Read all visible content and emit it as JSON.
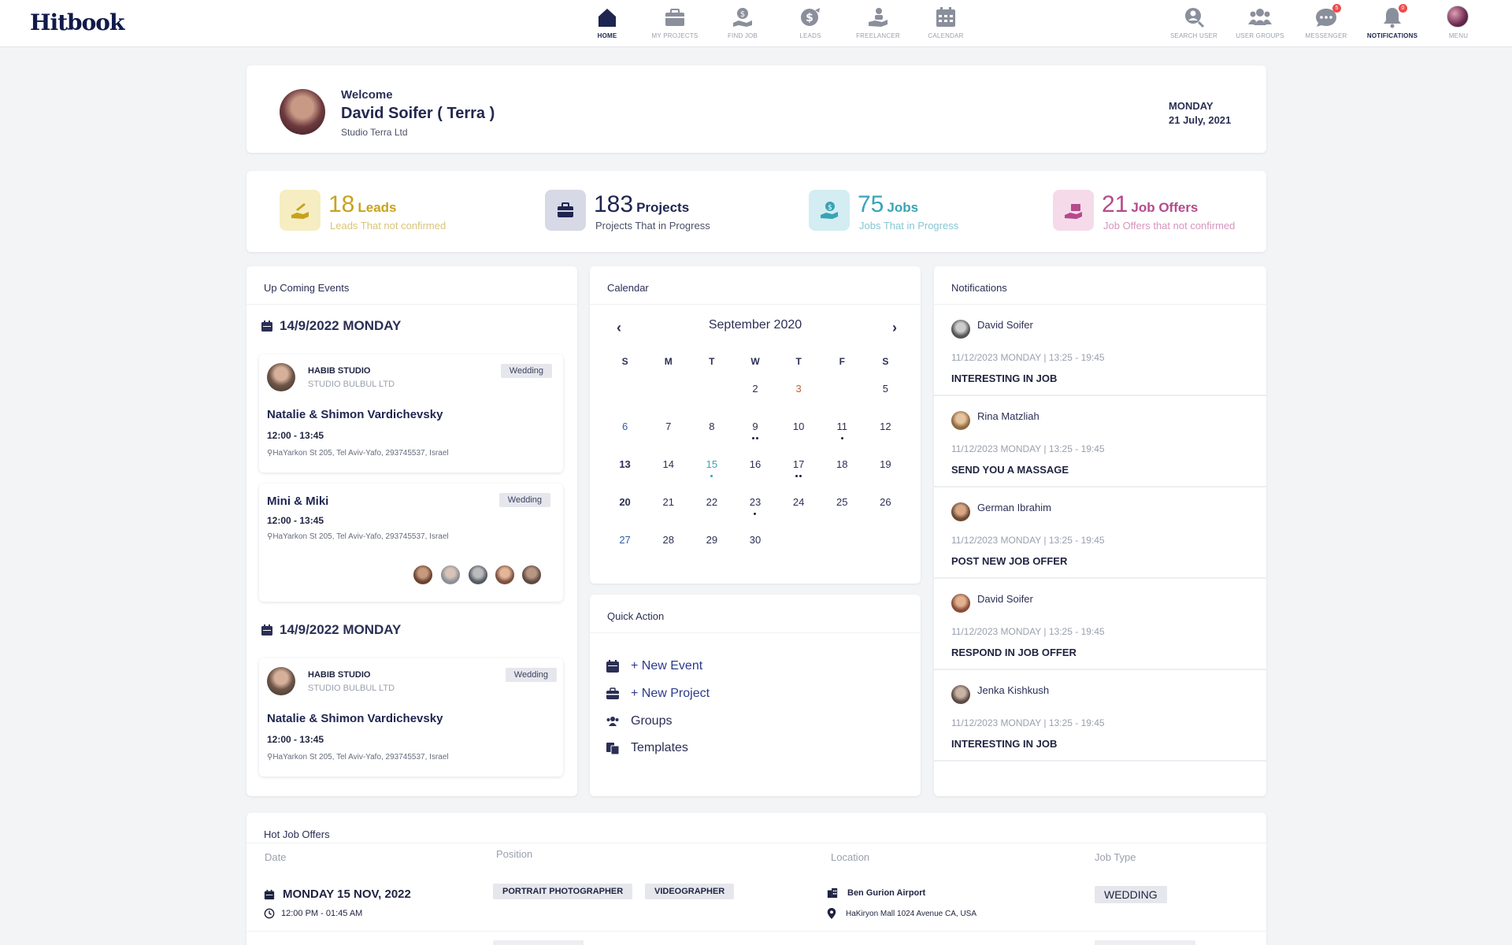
{
  "app": {
    "logo": "Hitbook"
  },
  "nav": {
    "center": [
      {
        "label": "HOME",
        "icon": "home-icon",
        "active": true
      },
      {
        "label": "MY PROJECTS",
        "icon": "briefcase-icon"
      },
      {
        "label": "FIND JOB",
        "icon": "find-job-icon"
      },
      {
        "label": "LEADS",
        "icon": "dollar-icon"
      },
      {
        "label": "FREELANCER",
        "icon": "freelancer-icon"
      },
      {
        "label": "CALENDAR",
        "icon": "calendar-icon"
      }
    ],
    "right": [
      {
        "label": "SEARCH USER",
        "icon": "search-user-icon"
      },
      {
        "label": "USER GROUPS",
        "icon": "user-groups-icon"
      },
      {
        "label": "MESSENGER",
        "icon": "messenger-icon",
        "badge": "5"
      },
      {
        "label": "NOTIFICATIONS",
        "icon": "bell-icon",
        "badge": "0"
      },
      {
        "label": "MENU",
        "icon": "avatar"
      }
    ]
  },
  "welcome": {
    "greeting": "Welcome",
    "name": "David Soifer ( Terra )",
    "company": "Studio Terra Ltd",
    "day": "MONDAY",
    "date": "21 July, 2021"
  },
  "stats": [
    {
      "number": "18",
      "label": "Leads",
      "sub": "Leads That not confirmed",
      "color": "#c8a21e",
      "bg": "#f6eec2",
      "icon": "leads-icon"
    },
    {
      "number": "183",
      "label": "Projects",
      "sub": "Projects That in Progress",
      "color": "#1f2550",
      "bg": "#d7d9e6",
      "icon": "projects-icon"
    },
    {
      "number": "75",
      "label": "Jobs",
      "sub": "Jobs That in Progress",
      "color": "#3aa3b6",
      "bg": "#d3edf2",
      "icon": "jobs-icon"
    },
    {
      "number": "21",
      "label": "Job Offers",
      "sub": "Job Offers that not confirmed",
      "color": "#b54a8c",
      "bg": "#f5dbe9",
      "icon": "job-offers-icon"
    }
  ],
  "events": {
    "title": "Up Coming Events",
    "groups": [
      {
        "day": "14/9/2022 MONDAY",
        "items": [
          {
            "studio": "HABIB STUDIO",
            "studio_sub": "STUDIO BULBUL LTD",
            "tag": "Wedding",
            "title": "Natalie & Shimon Vardichevsky",
            "time": "12:00 - 13:45",
            "address": "HaYarkon St 205, Tel Aviv-Yafo, 293745537, Israel"
          },
          {
            "tag": "Wedding",
            "title": "Mini & Miki",
            "time": "12:00 - 13:45",
            "address": "HaYarkon St 205, Tel Aviv-Yafo, 293745537, Israel"
          }
        ]
      },
      {
        "day": "14/9/2022 MONDAY",
        "items": [
          {
            "studio": "HABIB STUDIO",
            "studio_sub": "STUDIO BULBUL LTD",
            "tag": "Wedding",
            "title": "Natalie & Shimon Vardichevsky",
            "time": "12:00 - 13:45",
            "address": "HaYarkon St 205, Tel Aviv-Yafo, 293745537, Israel"
          }
        ]
      }
    ]
  },
  "calendar": {
    "title": "Calendar",
    "month": "September 2020",
    "weekdays": [
      "S",
      "M",
      "T",
      "W",
      "T",
      "F",
      "S"
    ],
    "weeks": [
      [
        "",
        "",
        "",
        "2",
        "3",
        "",
        "5"
      ],
      [
        "6",
        "7",
        "8",
        "9",
        "10",
        "11",
        "12"
      ],
      [
        "13",
        "14",
        "15",
        "16",
        "17",
        "18",
        "19"
      ],
      [
        "20",
        "21",
        "22",
        "23",
        "24",
        "25",
        "26"
      ],
      [
        "27",
        "28",
        "29",
        "30",
        "",
        "",
        ""
      ]
    ],
    "dots": {
      "9": 2,
      "11": 1,
      "15": 1,
      "17": 2,
      "23": 1
    },
    "colors": {
      "3": "#c0603a",
      "6": "#2d5fa8",
      "15": "#3aa3b6",
      "27": "#2d5fa8"
    },
    "bold": [
      "13",
      "20"
    ]
  },
  "quick_action": {
    "title": "Quick Action",
    "items": [
      {
        "label": "+ New Event",
        "icon": "calendar-icon",
        "color": "#2d3a8c"
      },
      {
        "label": "+ New Project",
        "icon": "briefcase-icon",
        "color": "#2d3a8c"
      },
      {
        "label": "Groups",
        "icon": "groups-icon",
        "color": "#2b2f55"
      },
      {
        "label": "Templates",
        "icon": "templates-icon",
        "color": "#2b2f55"
      }
    ]
  },
  "notifications": {
    "title": "Notifications",
    "items": [
      {
        "name": "David Soifer",
        "date": "11/12/2023 MONDAY",
        "time": "13:25 - 19:45",
        "title": "INTERESTING IN JOB"
      },
      {
        "name": "Rina Matzliah",
        "date": "11/12/2023 MONDAY",
        "time": "13:25 - 19:45",
        "title": "SEND YOU A MASSAGE"
      },
      {
        "name": "German Ibrahim",
        "date": "11/12/2023 MONDAY",
        "time": "13:25 - 19:45",
        "title": "POST NEW JOB OFFER"
      },
      {
        "name": "David Soifer",
        "date": "11/12/2023 MONDAY",
        "time": "13:25 - 19:45",
        "title": "RESPOND IN JOB OFFER"
      },
      {
        "name": "Jenka Kishkush",
        "date": "11/12/2023 MONDAY",
        "time": "13:25 - 19:45",
        "title": "INTERESTING IN JOB"
      }
    ]
  },
  "hot_jobs": {
    "title": "Hot Job Offers",
    "columns": [
      "Date",
      "Position",
      "Location",
      "Job Type"
    ],
    "rows": [
      {
        "date": "MONDAY 15 NOV, 2022",
        "time": "12:00 PM - 01:45 AM",
        "positions": [
          "PORTRAIT PHOTOGRAPHER",
          "VIDEOGRAPHER"
        ],
        "place": "Ben Gurion Airport",
        "address": "HaKiryon Mall 1024 Avenue CA, USA",
        "type": "WEDDING"
      }
    ]
  }
}
